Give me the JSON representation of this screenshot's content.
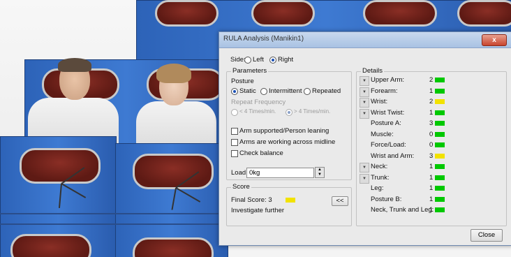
{
  "dialog": {
    "title": "RULA Analysis (Manikin1)",
    "close_glyph": "x",
    "side": {
      "label": "Side:",
      "left": "Left",
      "right": "Right",
      "selected": "Right"
    },
    "parameters": {
      "legend": "Parameters",
      "posture_label": "Posture",
      "posture_options": [
        "Static",
        "Intermittent",
        "Repeated"
      ],
      "posture_selected": "Static",
      "repeat_label": "Repeat Frequency",
      "repeat_options": [
        "< 4 Times/min.",
        "> 4 Times/min."
      ],
      "repeat_selected": "> 4 Times/min.",
      "checks": [
        "Arm supported/Person leaning",
        "Arms are working across midline",
        "Check balance"
      ],
      "load_label": "Load:",
      "load_value": "0kg"
    },
    "score": {
      "legend": "Score",
      "final": "Final Score: 3",
      "final_color": "#f2e200",
      "advice": "Investigate further",
      "collapse_label": "<<"
    },
    "details": {
      "legend": "Details",
      "rows": [
        {
          "label": "Upper Arm:",
          "value": "2",
          "color": "#00c800",
          "expander": true
        },
        {
          "label": "Forearm:",
          "value": "1",
          "color": "#00c800",
          "expander": true
        },
        {
          "label": "Wrist:",
          "value": "2",
          "color": "#f2e200",
          "expander": true
        },
        {
          "label": "Wrist Twist:",
          "value": "1",
          "color": "#00c800",
          "expander": true
        },
        {
          "label": "Posture A:",
          "value": "3",
          "color": "#00c800",
          "expander": false
        },
        {
          "label": "Muscle:",
          "value": "0",
          "color": "#00c800",
          "expander": false
        },
        {
          "label": "Force/Load:",
          "value": "0",
          "color": "#00c800",
          "expander": false
        },
        {
          "label": "Wrist and Arm:",
          "value": "3",
          "color": "#f2e200",
          "expander": false
        },
        {
          "label": "Neck:",
          "value": "1",
          "color": "#00c800",
          "expander": true
        },
        {
          "label": "Trunk:",
          "value": "1",
          "color": "#00c800",
          "expander": true
        },
        {
          "label": "Leg:",
          "value": "1",
          "color": "#00c800",
          "expander": false
        },
        {
          "label": "Posture B:",
          "value": "1",
          "color": "#00c800",
          "expander": false
        },
        {
          "label": "Neck, Trunk and Leg:",
          "value": "1",
          "color": "#00c800",
          "expander": false
        }
      ]
    },
    "close_button": "Close"
  }
}
